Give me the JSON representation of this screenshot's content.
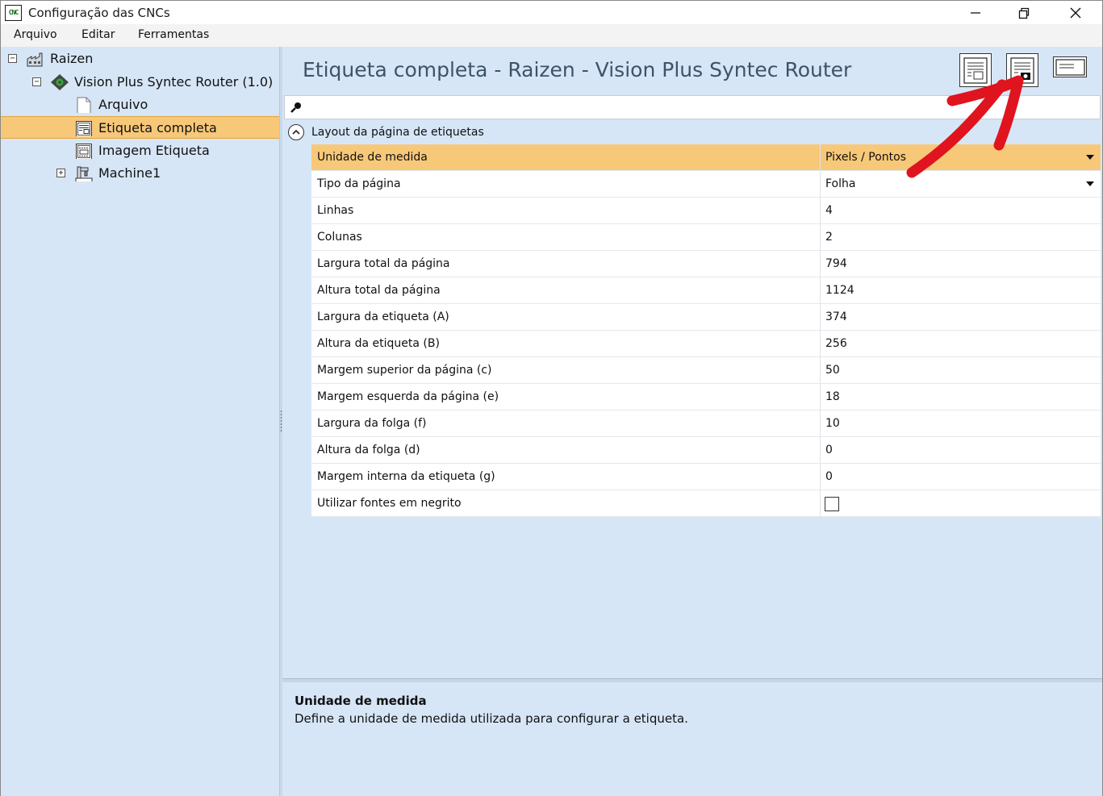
{
  "window": {
    "title": "Configuração das CNCs",
    "app_icon_text": "CNC"
  },
  "menu": {
    "items": [
      "Arquivo",
      "Editar",
      "Ferramentas"
    ]
  },
  "tree": {
    "items": [
      {
        "label": "Raizen",
        "expander": "−",
        "icon": "factory-icon"
      },
      {
        "label": "Vision Plus Syntec Router (1.0)",
        "expander": "−",
        "icon": "gear-diamond-icon"
      },
      {
        "label": "Arquivo",
        "icon": "document-icon"
      },
      {
        "label": "Etiqueta completa",
        "icon": "label-page-icon",
        "selected": true
      },
      {
        "label": "Imagem Etiqueta",
        "icon": "label-image-icon"
      },
      {
        "label": "Machine1",
        "expander": "+",
        "icon": "machine-icon"
      }
    ]
  },
  "header": {
    "title": "Etiqueta completa - Raizen - Vision Plus Syntec Router",
    "tools": [
      "full-label-layout-icon",
      "label-image-capture-icon",
      "single-label-icon"
    ]
  },
  "properties": {
    "category": "Layout da página de etiquetas",
    "rows": [
      {
        "name": "Unidade de medida",
        "value": "Pixels / Pontos",
        "dropdown": true,
        "selected": true
      },
      {
        "name": "Tipo da página",
        "value": "Folha",
        "dropdown": true
      },
      {
        "name": "Linhas",
        "value": "4"
      },
      {
        "name": "Colunas",
        "value": "2"
      },
      {
        "name": "Largura total da página",
        "value": "794"
      },
      {
        "name": "Altura total da página",
        "value": "1124"
      },
      {
        "name": "Largura da etiqueta (A)",
        "value": "374"
      },
      {
        "name": "Altura da etiqueta (B)",
        "value": "256"
      },
      {
        "name": "Margem superior da página (c)",
        "value": "50"
      },
      {
        "name": "Margem esquerda da página (e)",
        "value": "18"
      },
      {
        "name": "Largura da folga (f)",
        "value": "10"
      },
      {
        "name": "Altura da folga (d)",
        "value": "0"
      },
      {
        "name": "Margem interna da etiqueta (g)",
        "value": "0"
      },
      {
        "name": "Utilizar fontes em negrito",
        "value": "",
        "checkbox": false
      }
    ]
  },
  "description": {
    "title": "Unidade de medida",
    "text": "Define a unidade de medida utilizada para configurar a etiqueta."
  },
  "colors": {
    "panel_bg": "#d6e6f7",
    "selection": "#f8c879",
    "header_text": "#3d5368",
    "annotation_arrow": "#e0141e"
  }
}
